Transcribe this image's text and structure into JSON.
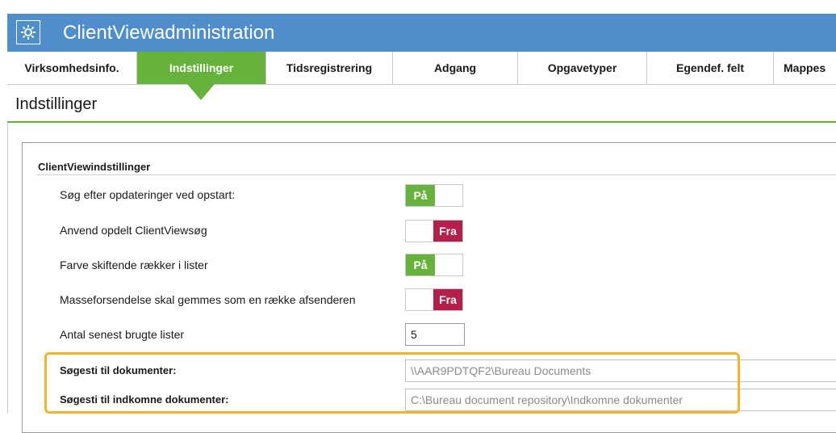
{
  "window": {
    "title": "ClientViewadministration",
    "icon": "gear-icon"
  },
  "tabs": [
    {
      "label": "Virksomhedsinfo.",
      "active": false
    },
    {
      "label": "Indstillinger",
      "active": true
    },
    {
      "label": "Tidsregistrering",
      "active": false
    },
    {
      "label": "Adgang",
      "active": false
    },
    {
      "label": "Opgavetyper",
      "active": false
    },
    {
      "label": "Egendef. felt",
      "active": false
    },
    {
      "label": "Mappes",
      "active": false
    }
  ],
  "page": {
    "title": "Indstillinger"
  },
  "group": {
    "title": "ClientViewindstillinger",
    "settings": [
      {
        "label": "Søg efter opdateringer ved opstart:",
        "state": "on",
        "state_label": "På"
      },
      {
        "label": "Anvend opdelt ClientViewsøg",
        "state": "off",
        "state_label": "Fra"
      },
      {
        "label": "Farve skiftende rækker i lister",
        "state": "on",
        "state_label": "På"
      },
      {
        "label": "Masseforsendelse skal gemmes som en række afsenderen",
        "state": "off",
        "state_label": "Fra"
      }
    ],
    "recent_lists": {
      "label": "Antal senest brugte lister",
      "value": "5"
    },
    "document_path": {
      "label": "Søgesti til dokumenter:",
      "value": "\\\\AAR9PDTQF2\\Bureau Documents"
    },
    "incoming_path": {
      "label": "Søgesti til indkomne dokumenter:",
      "value": "C:\\Bureau document repository\\Indkomne dokumenter"
    }
  },
  "colors": {
    "titlebar": "#4f8ecb",
    "accent_green": "#66b23c",
    "toggle_off": "#b4204a",
    "highlight": "#f0b431"
  }
}
